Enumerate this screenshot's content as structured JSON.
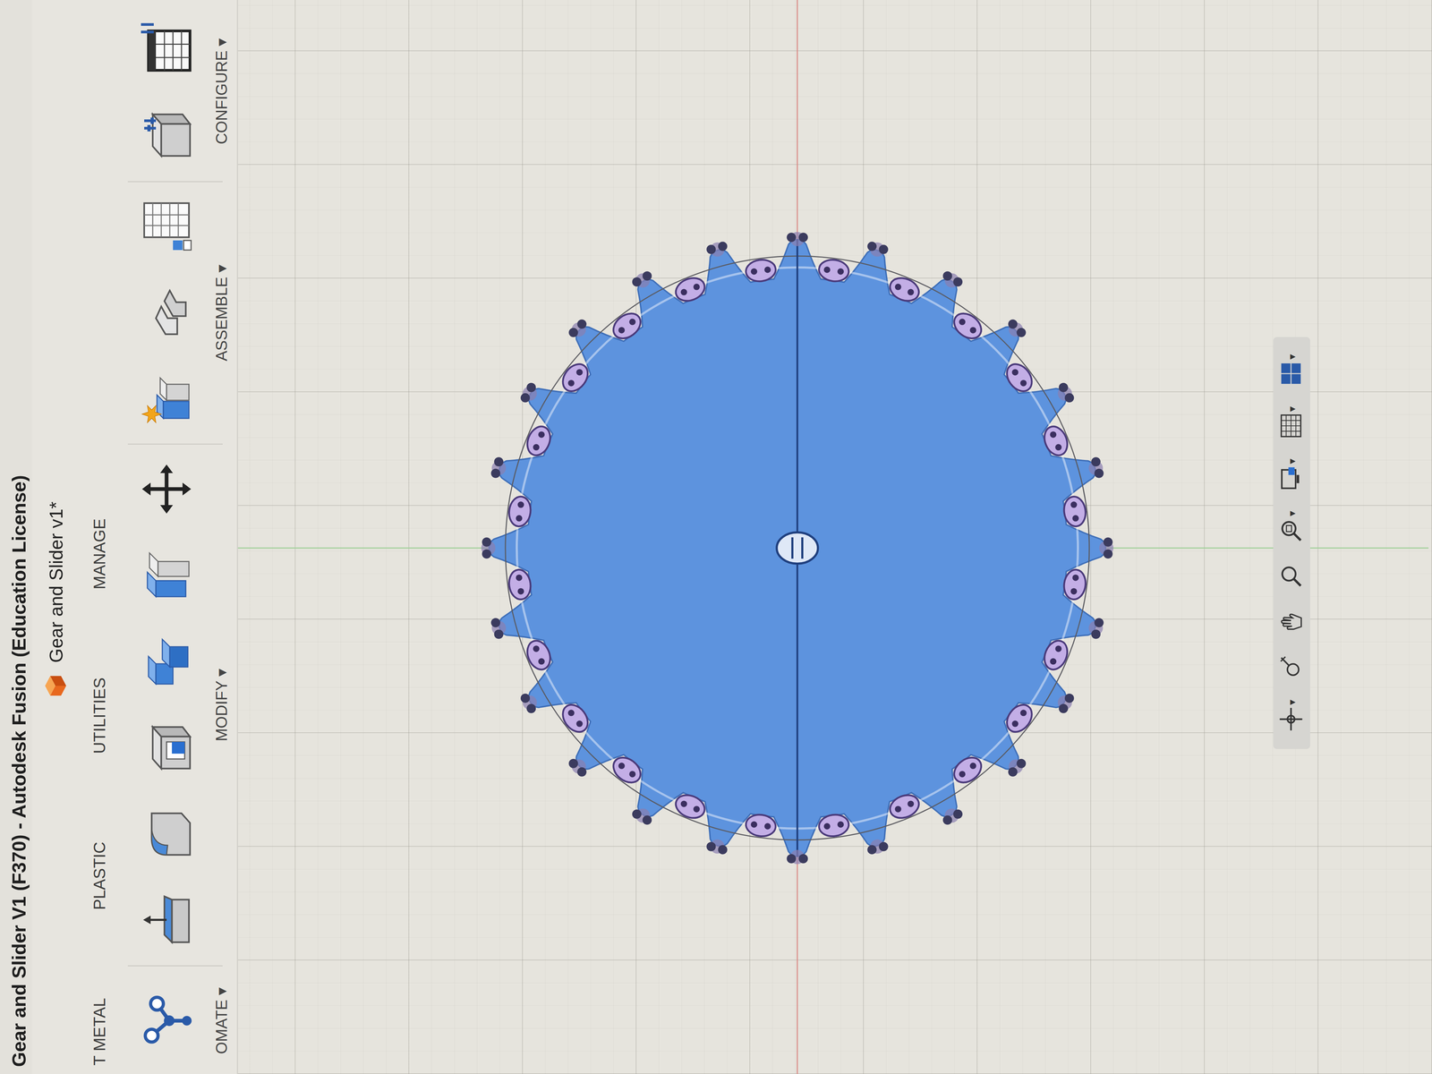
{
  "window": {
    "title": "Gear and Slider V1 (F370) - Autodesk Fusion (Education License)"
  },
  "document_tab": {
    "label": "Gear and Slider v1*",
    "selected": true
  },
  "workspace_tabs": [
    {
      "label": "T METAL",
      "selected": false
    },
    {
      "label": "PLASTIC",
      "selected": false
    },
    {
      "label": "UTILITIES",
      "selected": false
    },
    {
      "label": "MANAGE",
      "selected": false
    }
  ],
  "tool_groups": [
    {
      "label": "OMATE ▾"
    },
    {
      "label": "MODIFY ▾"
    },
    {
      "label": "ASSEMBLE ▾"
    },
    {
      "label": "CONFIGURE ▾"
    }
  ],
  "sketch": {
    "teeth": 24
  },
  "nav_caret": "▾",
  "nav_tools": [
    {
      "has_menu": true
    },
    {
      "has_menu": false
    },
    {
      "has_menu": false
    },
    {
      "has_menu": false
    },
    {
      "has_menu": true
    },
    {
      "has_menu": true
    },
    {
      "has_menu": true
    },
    {
      "has_menu": true
    }
  ]
}
